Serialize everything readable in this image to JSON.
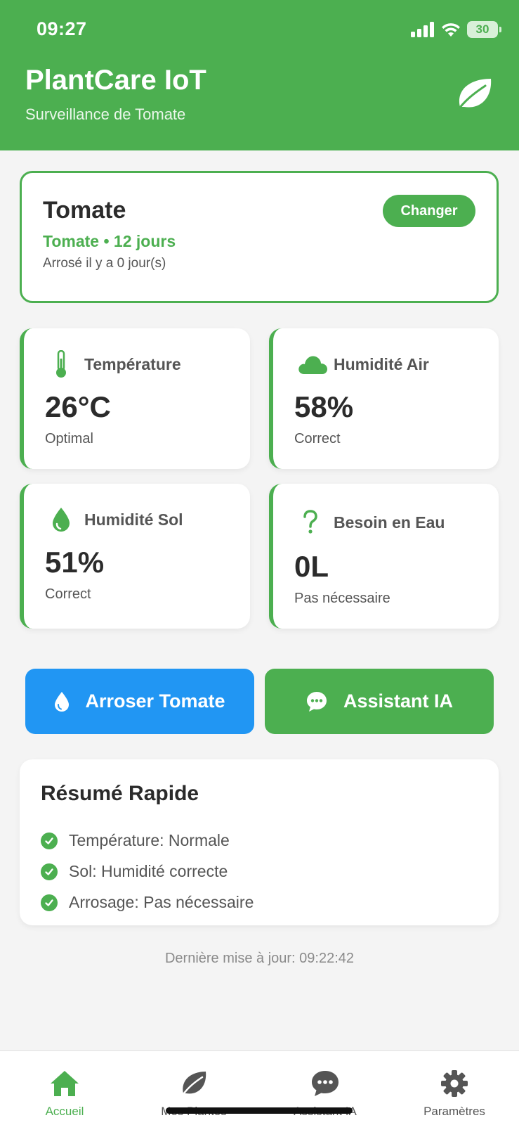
{
  "status_bar": {
    "time": "09:27",
    "battery": "30"
  },
  "header": {
    "title": "PlantCare IoT",
    "subtitle": "Surveillance de Tomate"
  },
  "plant_card": {
    "name": "Tomate",
    "meta": "Tomate • 12 jours",
    "watered": "Arrosé il y a 0 jour(s)",
    "change_label": "Changer"
  },
  "metrics": [
    {
      "label": "Température",
      "value": "26°C",
      "status": "Optimal",
      "icon": "thermometer-icon"
    },
    {
      "label": "Humidité Air",
      "value": "58%",
      "status": "Correct",
      "icon": "cloud-icon"
    },
    {
      "label": "Humidité Sol",
      "value": "51%",
      "status": "Correct",
      "icon": "water-drop-icon"
    },
    {
      "label": "Besoin en Eau",
      "value": "0L",
      "status": "Pas nécessaire",
      "icon": "question-icon"
    }
  ],
  "actions": {
    "water_label": "Arroser Tomate",
    "ai_label": "Assistant IA"
  },
  "summary": {
    "title": "Résumé Rapide",
    "items": [
      "Température: Normale",
      "Sol: Humidité correcte",
      "Arrosage: Pas nécessaire"
    ]
  },
  "last_update": "Dernière mise à jour: 09:22:42",
  "nav": {
    "items": [
      {
        "label": "Accueil",
        "icon": "home-icon",
        "active": true
      },
      {
        "label": "Mes Plantes",
        "icon": "leaf-icon",
        "active": false
      },
      {
        "label": "Assistant IA",
        "icon": "chat-icon",
        "active": false
      },
      {
        "label": "Paramètres",
        "icon": "gear-icon",
        "active": false
      }
    ]
  },
  "colors": {
    "accent": "#4caf50",
    "water": "#2196f3",
    "background": "#f4f4f4"
  }
}
